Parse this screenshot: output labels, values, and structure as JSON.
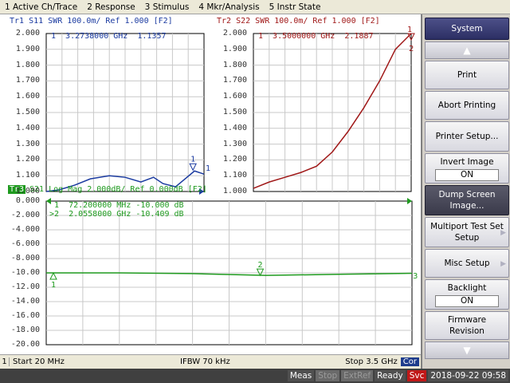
{
  "menu": [
    "1 Active Ch/Trace",
    "2 Response",
    "3 Stimulus",
    "4 Mkr/Analysis",
    "5 Instr State"
  ],
  "colors": {
    "s11": "#1a3aa0",
    "s22": "#a01818",
    "s21": "#1e9a1e",
    "marker_active": "#a01818"
  },
  "plots": {
    "s11": {
      "title": "Tr1 S11 SWR 100.0m/ Ref 1.000 [F2]",
      "marker_readout": "1  3.2738000 GHz  1.1357",
      "y_ticks": [
        "2.000",
        "1.900",
        "1.800",
        "1.700",
        "1.600",
        "1.500",
        "1.400",
        "1.300",
        "1.200",
        "1.100",
        "1.000"
      ],
      "marker_label": "1",
      "ref_label": "1"
    },
    "s22": {
      "title": "Tr2 S22 SWR 100.0m/ Ref 1.000 [F2]",
      "marker_readout": "1  3.5000000 GHz  2.1887",
      "y_ticks": [
        "2.000",
        "1.900",
        "1.800",
        "1.700",
        "1.600",
        "1.500",
        "1.400",
        "1.300",
        "1.200",
        "1.100",
        "1.000"
      ],
      "marker_label": "1",
      "ref_label": "2"
    },
    "s21": {
      "trace_key": "Tr3",
      "title": "S21 Log Mag 2.000dB/ Ref 0.000dB [F2]",
      "marker_readout_1": " 1  72.200000 MHz -10.000 dB",
      "marker_readout_2": ">2  2.0558000 GHz -10.409 dB",
      "y_ticks": [
        "0.000",
        "-2.000",
        "-4.000",
        "-6.000",
        "-8.000",
        "-10.00",
        "-12.00",
        "-14.00",
        "-16.00",
        "-18.00",
        "-20.00"
      ],
      "marker_labels": [
        "1",
        "2"
      ],
      "ref_label": "3"
    }
  },
  "side_panel": {
    "title": "System",
    "buttons": [
      {
        "label": "Print"
      },
      {
        "label": "Abort Printing"
      },
      {
        "label": "Printer Setup..."
      },
      {
        "label": "Invert Image",
        "value": "ON"
      },
      {
        "label": "Dump Screen Image..."
      },
      {
        "label": "Multiport Test Set Setup"
      },
      {
        "label": "Misc Setup"
      },
      {
        "label": "Backlight",
        "value": "ON"
      },
      {
        "label": "Firmware Revision"
      }
    ]
  },
  "stimulus": {
    "channel": "1",
    "start": "Start 20 MHz",
    "ifbw": "IFBW 70 kHz",
    "stop": "Stop 3.5 GHz",
    "cor": "Cor"
  },
  "status": {
    "meas": "Meas",
    "stop": "Stop",
    "extref": "ExtRef",
    "ready": "Ready",
    "svc": "Svc",
    "datetime": "2018-09-22 09:58"
  }
}
